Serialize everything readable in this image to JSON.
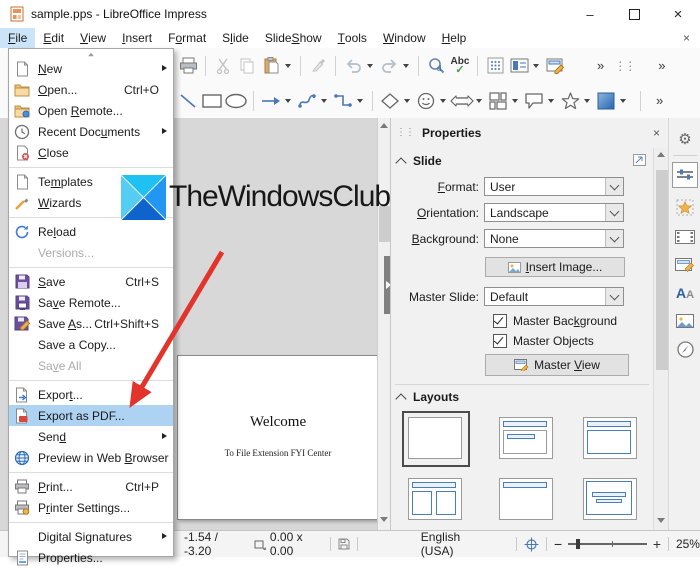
{
  "window": {
    "title": "sample.pps - LibreOffice Impress",
    "controls": {
      "minimize": "–",
      "close": "×"
    }
  },
  "menubar": {
    "items": [
      {
        "label": "File",
        "m": "F"
      },
      {
        "label": "Edit",
        "m": "E"
      },
      {
        "label": "View",
        "m": "V"
      },
      {
        "label": "Insert",
        "m": "I"
      },
      {
        "label": "Format",
        "m": "o"
      },
      {
        "label": "Slide",
        "m": "l"
      },
      {
        "label": "Slide Show",
        "m": "Sh"
      },
      {
        "label": "Tools",
        "m": "T"
      },
      {
        "label": "Window",
        "m": "W"
      },
      {
        "label": "Help",
        "m": "H"
      }
    ],
    "close_glyph": "×"
  },
  "file_menu": {
    "items": [
      {
        "label": "New",
        "m": "N"
      },
      {
        "label": "Open...",
        "shortcut": "Ctrl+O",
        "m": "O"
      },
      {
        "label": "Open Remote...",
        "m": "R"
      },
      {
        "label": "Recent Documents",
        "m": "u"
      },
      {
        "label": "Close",
        "m": "C"
      },
      {
        "label": "Templates",
        "m": "m"
      },
      {
        "label": "Wizards",
        "m": "W"
      },
      {
        "label": "Reload",
        "m": "l"
      },
      {
        "label": "Versions..."
      },
      {
        "label": "Save",
        "shortcut": "Ctrl+S",
        "m": "S"
      },
      {
        "label": "Save Remote...",
        "m": "v"
      },
      {
        "label": "Save As...",
        "shortcut": "Ctrl+Shift+S",
        "m": "As"
      },
      {
        "label": "Save a Copy..."
      },
      {
        "label": "Save All",
        "m": "v"
      },
      {
        "label": "Export...",
        "m": "t"
      },
      {
        "label": "Export as PDF..."
      },
      {
        "label": "Send",
        "m": "d"
      },
      {
        "label": "Preview in Web Browser",
        "m": "Br"
      },
      {
        "label": "Print...",
        "shortcut": "Ctrl+P",
        "m": "P"
      },
      {
        "label": "Printer Settings...",
        "m": "r"
      },
      {
        "label": "Digital Signatures"
      },
      {
        "label": "Properties..."
      }
    ]
  },
  "toolbars": {
    "overflow_glyph": "»",
    "spellcheck_label": "Abc",
    "spellcheck_check": "✓"
  },
  "watermark": {
    "text": "TheWindowsClub"
  },
  "slide": {
    "title": "Welcome",
    "subtitle": "To File Extension FYI Center"
  },
  "sidebar": {
    "title": "Properties",
    "close_glyph": "×",
    "slide_section": {
      "label": "Slide",
      "format_label": "Format:",
      "format_m": "F",
      "format_value": "User",
      "orientation_label": "Orientation:",
      "orientation_m": "O",
      "orientation_value": "Landscape",
      "background_label": "Background:",
      "background_m": "B",
      "background_value": "None",
      "insert_image_label": "Insert Image...",
      "insert_image_m": "I",
      "master_slide_label": "Master Slide:",
      "master_slide_value": "Default",
      "master_background_label": "Master Background",
      "master_background_m": "k",
      "master_objects_label": "Master Objects",
      "master_objects_m": "j",
      "master_view_label": "Master View",
      "master_view_m": "V"
    },
    "layouts_section": {
      "label": "Layouts"
    }
  },
  "statusbar": {
    "position": "-1.54 / -3.20",
    "object_size": "0.00 x 0.00",
    "language": "English (USA)",
    "zoom_out": "−",
    "zoom_in": "+",
    "zoom_level": "25%"
  },
  "colors": {
    "menu_item_highlight": "#aed2f2",
    "menubar_highlight": "#cce4f7",
    "arrow_red": "#e3342c",
    "logo_top": "#1ec1f2",
    "logo_left": "#55ccf2",
    "logo_right": "#2196f3",
    "logo_bottom": "#0f63cc"
  }
}
